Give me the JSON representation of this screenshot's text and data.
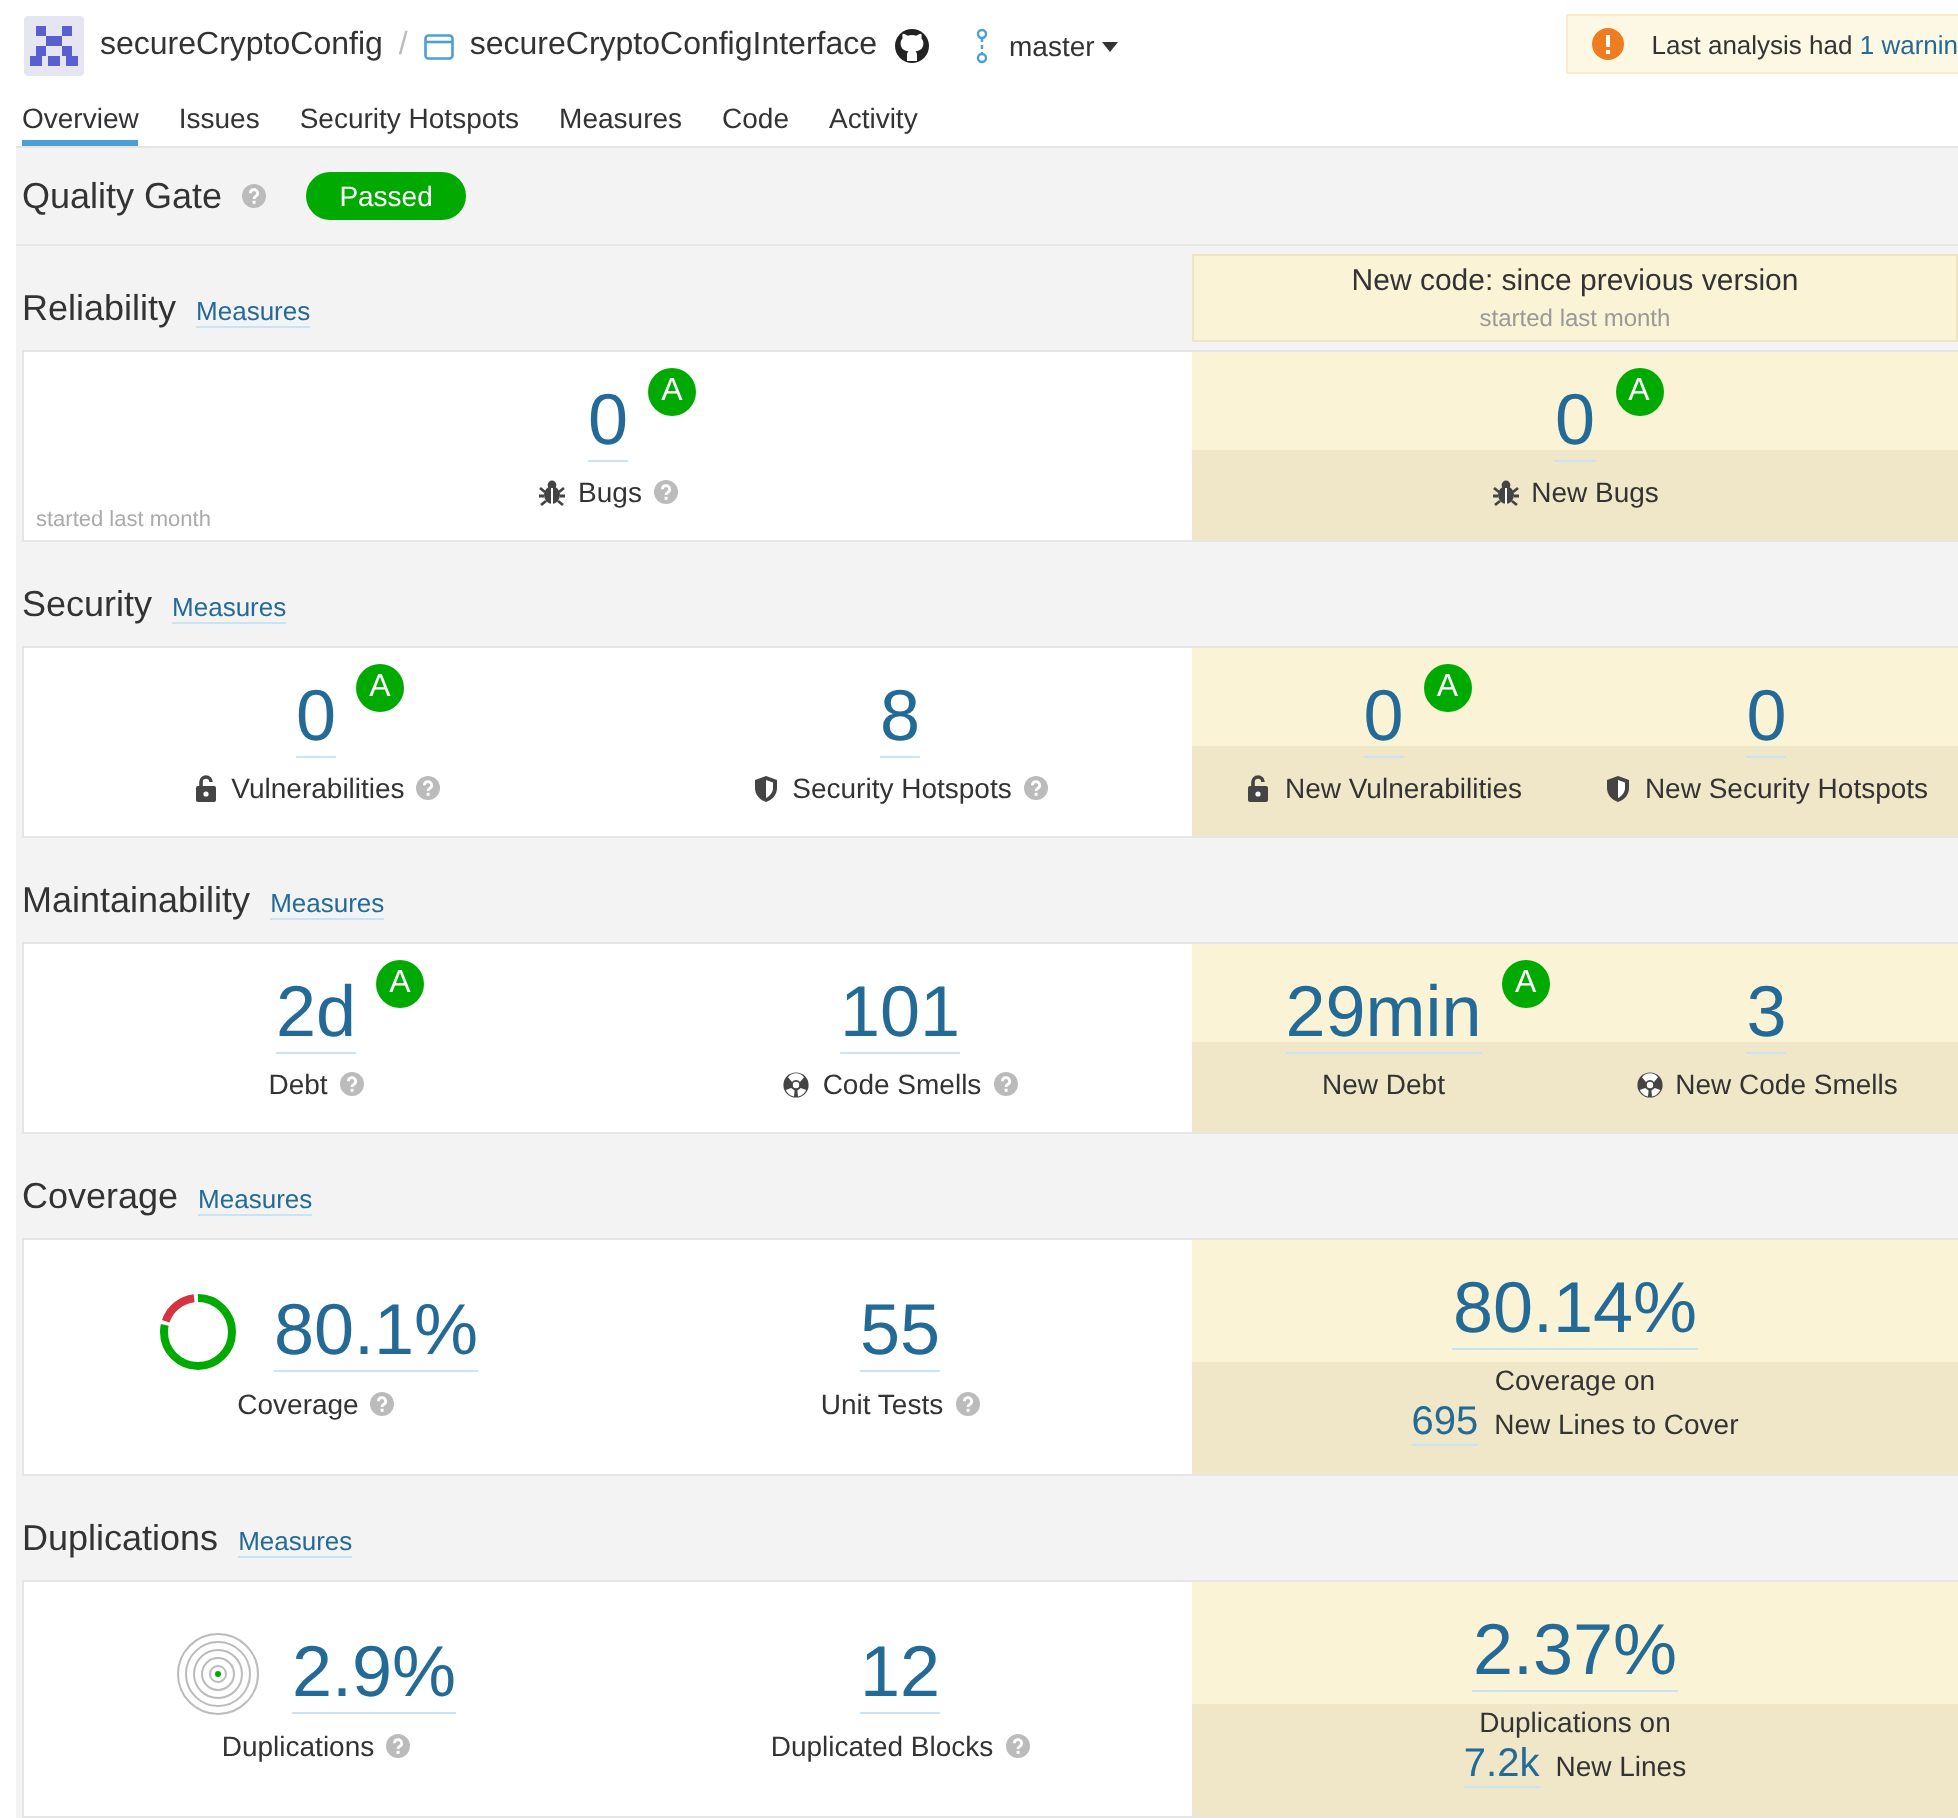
{
  "header": {
    "project": "secureCryptoConfig",
    "separator": "/",
    "repository": "secureCryptoConfigInterface",
    "branch": "master",
    "warning": {
      "text": "Last analysis had",
      "link": "1 warnin"
    }
  },
  "tabs": [
    {
      "label": "Overview",
      "selected": true
    },
    {
      "label": "Issues",
      "selected": false
    },
    {
      "label": "Security Hotspots",
      "selected": false
    },
    {
      "label": "Measures",
      "selected": false
    },
    {
      "label": "Code",
      "selected": false
    },
    {
      "label": "Activity",
      "selected": false
    }
  ],
  "quality_gate": {
    "label": "Quality Gate",
    "status": "Passed"
  },
  "new_code": {
    "title": "New code: since previous version",
    "subtitle": "started last month"
  },
  "sections": [
    {
      "title": "Reliability",
      "link": "Measures",
      "footnote": "started last month",
      "overall": [
        {
          "kind": "bug",
          "value": "0",
          "rating": "A",
          "label": "Bugs",
          "help": true
        }
      ],
      "new_code": [
        {
          "kind": "bug",
          "value": "0",
          "rating": "A",
          "label": "New Bugs",
          "help": false
        }
      ]
    },
    {
      "title": "Security",
      "link": "Measures",
      "overall": [
        {
          "kind": "lock",
          "value": "0",
          "rating": "A",
          "label": "Vulnerabilities",
          "help": true
        },
        {
          "kind": "shield",
          "value": "8",
          "label": "Security Hotspots",
          "help": true
        }
      ],
      "new_code": [
        {
          "kind": "lock",
          "value": "0",
          "rating": "A",
          "label": "New Vulnerabilities",
          "help": false
        },
        {
          "kind": "shield",
          "value": "0",
          "label": "New Security Hotspots",
          "help": false
        }
      ]
    },
    {
      "title": "Maintainability",
      "link": "Measures",
      "overall": [
        {
          "kind": "plain",
          "value": "2d",
          "rating": "A",
          "label": "Debt",
          "help": true
        },
        {
          "kind": "smell",
          "value": "101",
          "label": "Code Smells",
          "help": true
        }
      ],
      "new_code": [
        {
          "kind": "plain",
          "value": "29min",
          "rating": "A",
          "label": "New Debt",
          "help": false
        },
        {
          "kind": "smell",
          "value": "3",
          "label": "New Code Smells",
          "help": false
        }
      ]
    },
    {
      "title": "Coverage",
      "link": "Measures",
      "overall": [
        {
          "kind": "donut",
          "value": "80.1%",
          "level": 0.801,
          "label": "Coverage",
          "help": true
        },
        {
          "kind": "plain",
          "value": "55",
          "label": "Unit Tests",
          "help": true
        }
      ],
      "new_code": [
        {
          "kind": "plain",
          "value": "80.14%",
          "label": "Coverage on",
          "sub_value": "695",
          "sub_label": "New Lines to Cover",
          "help": false
        }
      ]
    },
    {
      "title": "Duplications",
      "link": "Measures",
      "overall": [
        {
          "kind": "rings",
          "value": "2.9%",
          "label": "Duplications",
          "help": true
        },
        {
          "kind": "plain",
          "value": "12",
          "label": "Duplicated Blocks",
          "help": true
        }
      ],
      "new_code": [
        {
          "kind": "plain",
          "value": "2.37%",
          "label": "Duplications on",
          "sub_value": "7.2k",
          "sub_label": "New Lines",
          "help": false
        }
      ]
    }
  ]
}
